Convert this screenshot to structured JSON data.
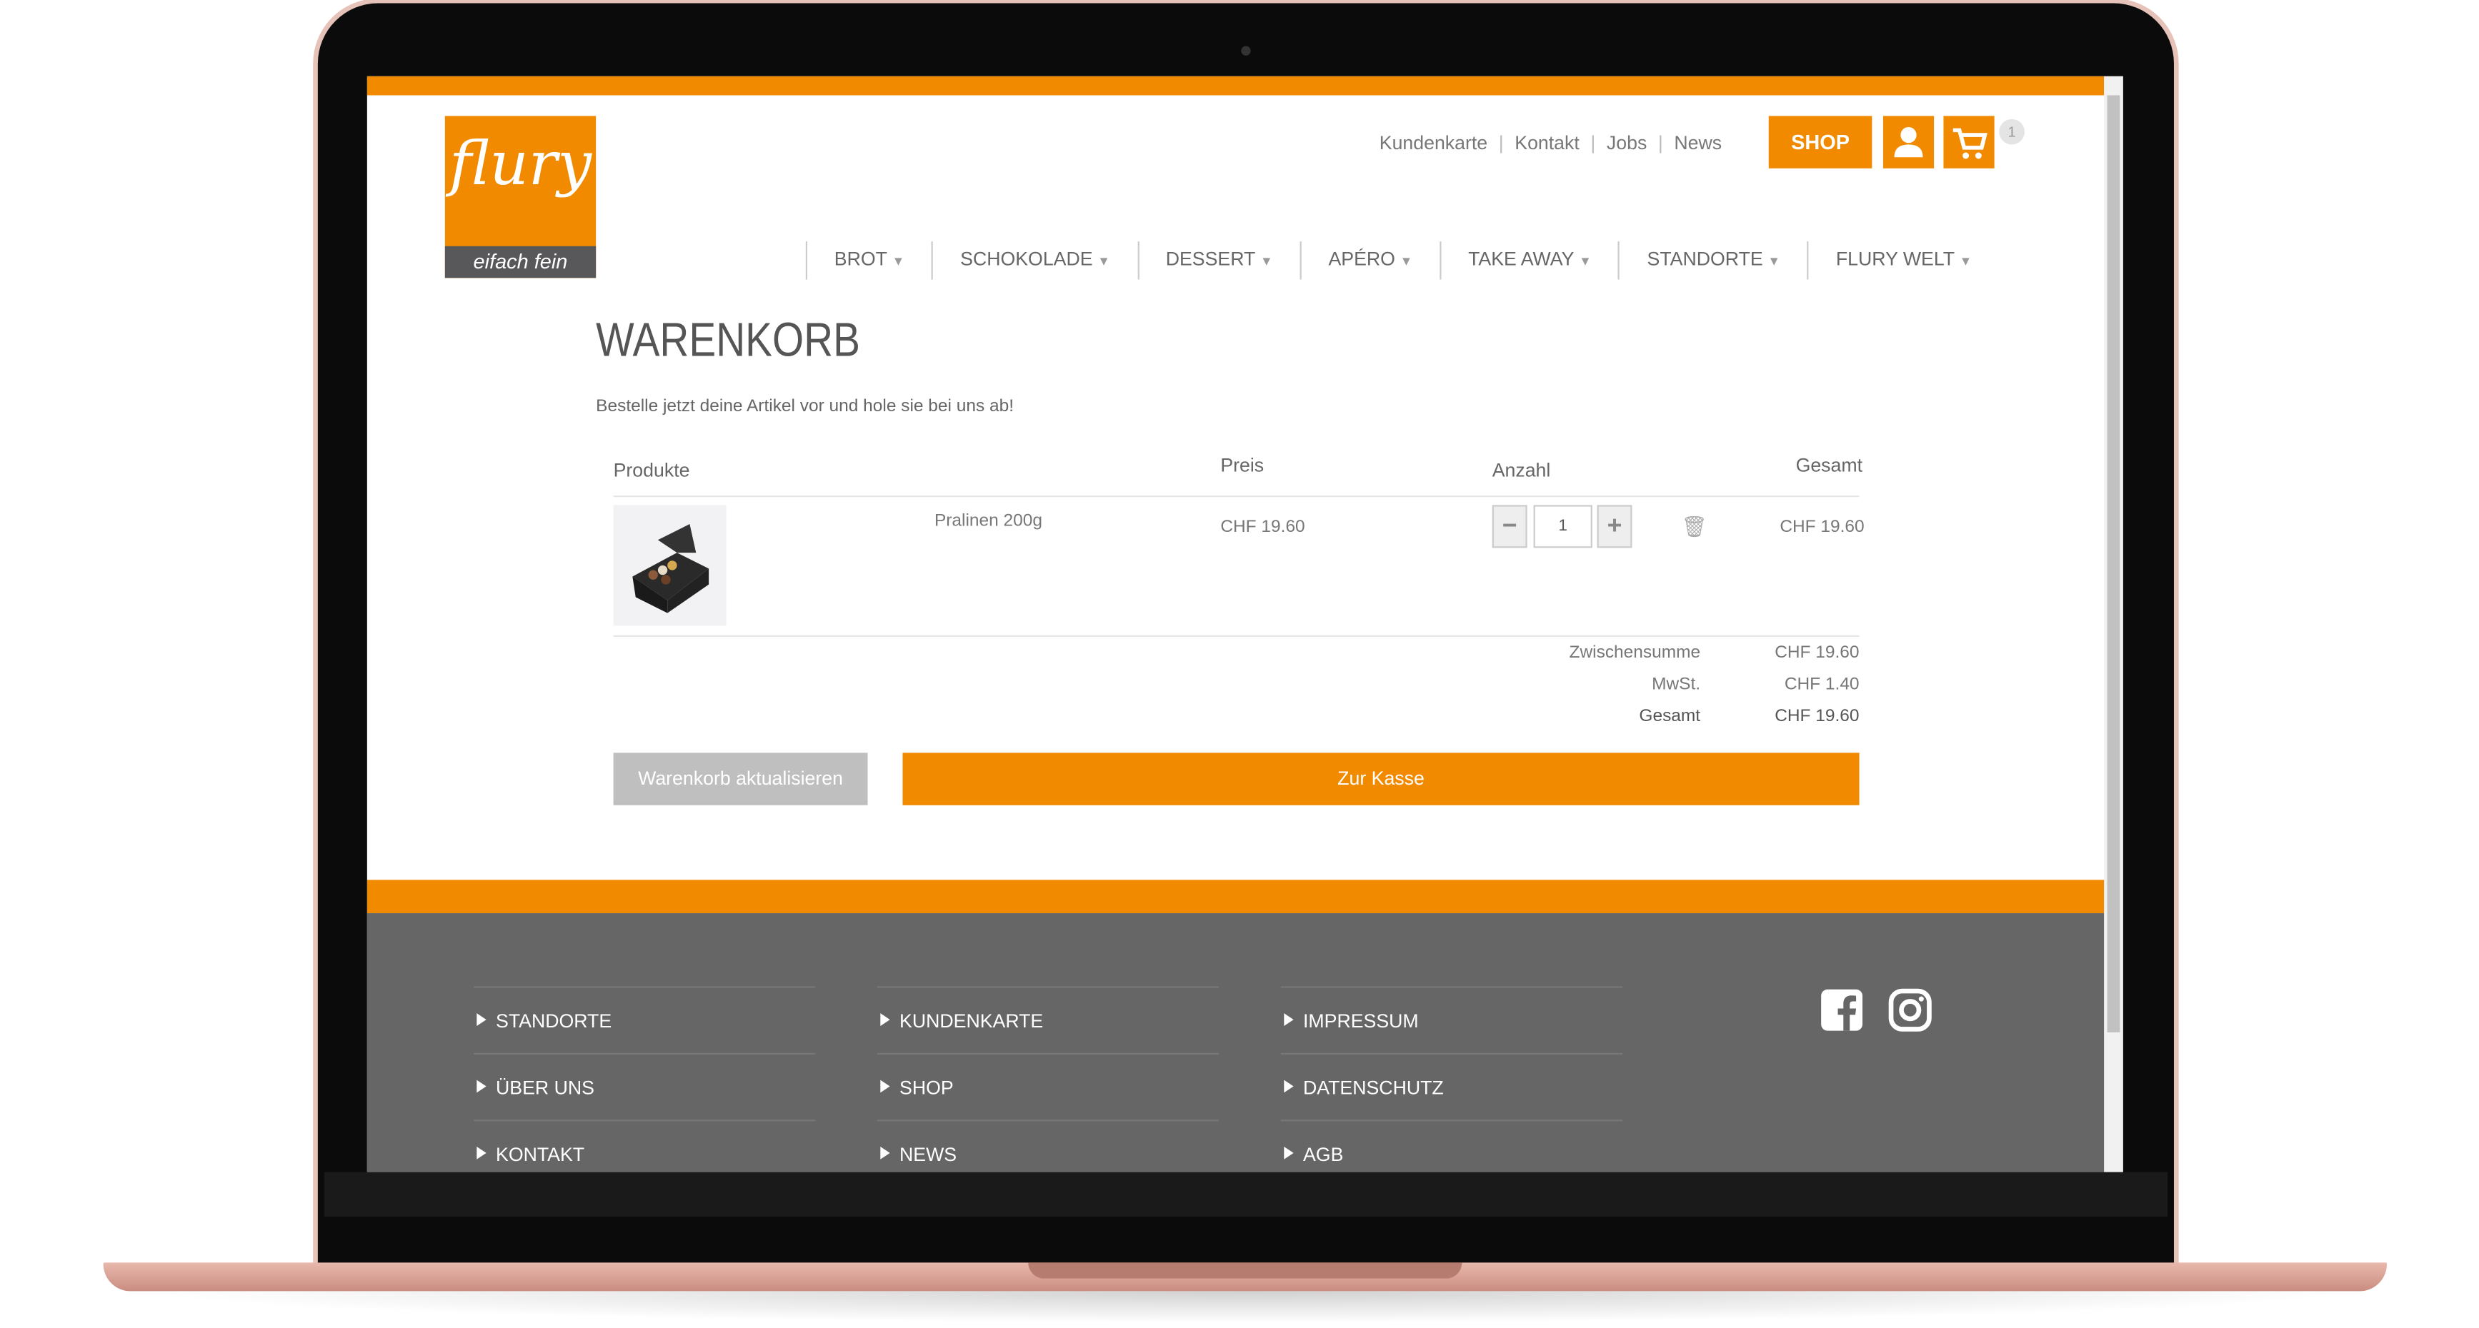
{
  "header": {
    "logo_text": "flury",
    "logo_tagline": "eifach fein",
    "top_links": [
      "Kundenkarte",
      "Kontakt",
      "Jobs",
      "News"
    ],
    "shop_label": "SHOP",
    "cart_count": "1"
  },
  "nav": {
    "items": [
      "BROT",
      "SCHOKOLADE",
      "DESSERT",
      "APÉRO",
      "TAKE AWAY",
      "STANDORTE",
      "FLURY WELT"
    ]
  },
  "cart": {
    "title": "WARENKORB",
    "subtitle": "Bestelle jetzt deine Artikel vor und hole sie bei uns ab!",
    "columns": {
      "products": "Produkte",
      "price": "Preis",
      "quantity": "Anzahl",
      "total": "Gesamt"
    },
    "items": [
      {
        "name": "Pralinen 200g",
        "price": "CHF 19.60",
        "quantity": "1",
        "total": "CHF 19.60"
      }
    ],
    "summary": [
      {
        "label": "Zwischensumme",
        "value": "CHF 19.60"
      },
      {
        "label": "MwSt.",
        "value": "CHF 1.40"
      },
      {
        "label": "Gesamt",
        "value": "CHF 19.60"
      }
    ],
    "update_label": "Warenkorb aktualisieren",
    "checkout_label": "Zur Kasse"
  },
  "footer": {
    "col1": [
      "STANDORTE",
      "ÜBER UNS",
      "KONTAKT"
    ],
    "col2": [
      "KUNDENKARTE",
      "SHOP",
      "NEWS"
    ],
    "col3": [
      "IMPRESSUM",
      "DATENSCHUTZ",
      "AGB"
    ]
  },
  "colors": {
    "brand": "#f28a00",
    "footer": "#666666",
    "logo_band": "#58585a"
  }
}
